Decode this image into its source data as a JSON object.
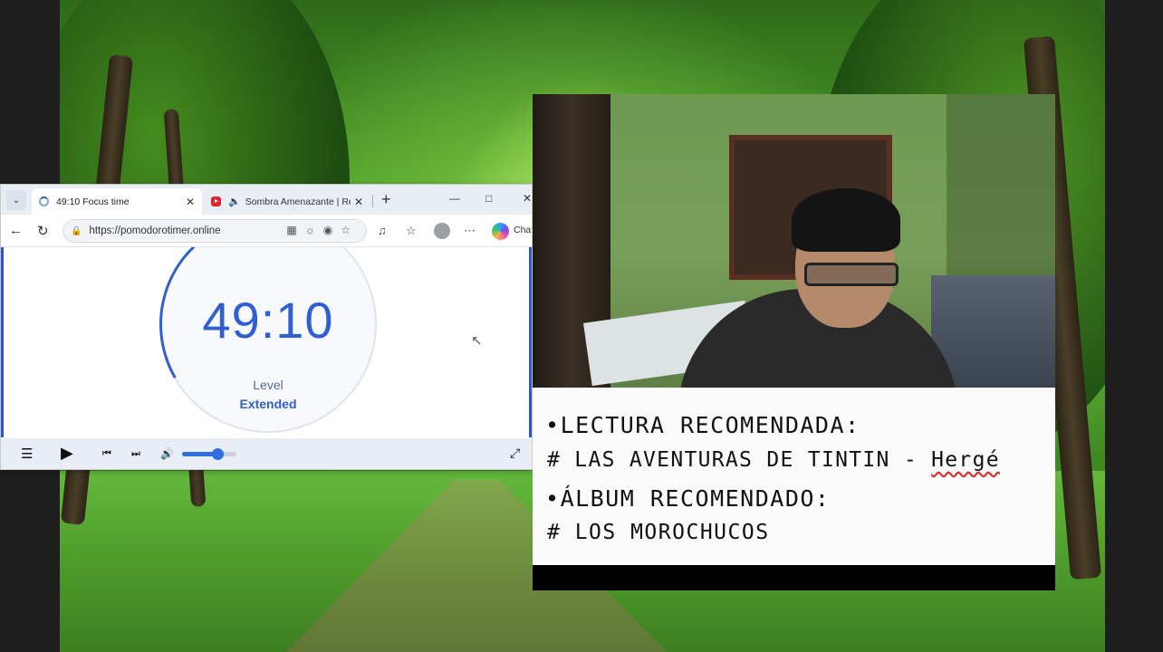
{
  "browser": {
    "tabs": [
      {
        "title": "49:10 Focus time",
        "active": true
      },
      {
        "title": "Sombra Amenazante | Re",
        "active": false
      }
    ],
    "url": "https://pomodorotimer.online",
    "chat_label": "Chat"
  },
  "timer": {
    "value": "49:10",
    "level_label": "Level",
    "level_value": "Extended",
    "progress_fraction": 0.06
  },
  "player": {
    "volume_fraction": 0.65
  },
  "panel": {
    "line1": "LECTURA RECOMENDADA:",
    "line2_prefix": "# LAS AVENTURAS DE TINTIN - ",
    "line2_author": "Hergé",
    "line3": "ÁLBUM RECOMENDADO:",
    "line4": "# LOS MOROCHUCOS",
    "bullet": "•"
  },
  "colors": {
    "timer_blue": "#2f5fd0",
    "page_border": "#3056c2",
    "player_accent": "#2f6fe0"
  }
}
